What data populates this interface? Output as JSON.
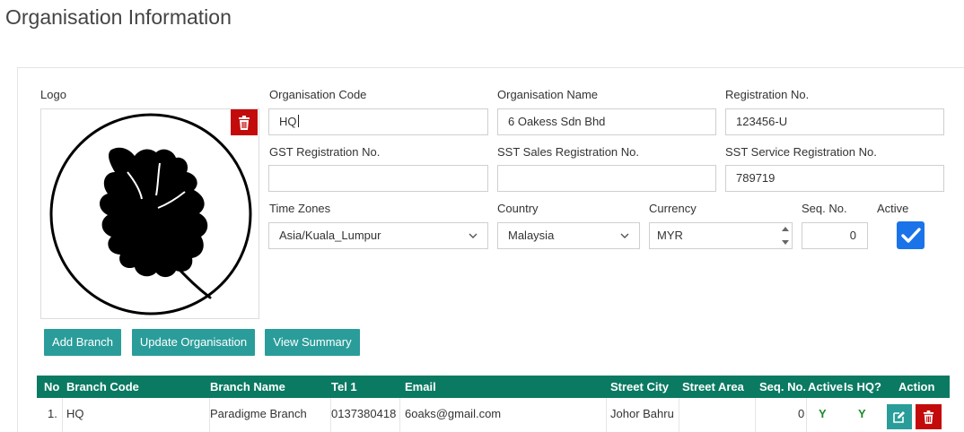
{
  "page": {
    "title": "Organisation Information"
  },
  "form": {
    "logo_label": "Logo",
    "org_code": {
      "label": "Organisation Code",
      "value": "HQ"
    },
    "org_name": {
      "label": "Organisation Name",
      "value": "6 Oakess Sdn Bhd"
    },
    "reg_no": {
      "label": "Registration No.",
      "value": "123456-U"
    },
    "gst_reg": {
      "label": "GST Registration No.",
      "value": ""
    },
    "sst_sales": {
      "label": "SST Sales Registration No.",
      "value": ""
    },
    "sst_service": {
      "label": "SST Service Registration No.",
      "value": "789719"
    },
    "timezone": {
      "label": "Time Zones",
      "value": "Asia/Kuala_Lumpur"
    },
    "country": {
      "label": "Country",
      "value": "Malaysia"
    },
    "currency": {
      "label": "Currency",
      "value": "MYR"
    },
    "seq_no": {
      "label": "Seq. No.",
      "value": "0"
    },
    "active": {
      "label": "Active",
      "checked": true
    }
  },
  "buttons": {
    "add_branch": "Add Branch",
    "update_org": "Update Organisation",
    "view_summary": "View Summary"
  },
  "table": {
    "headers": {
      "no": "No",
      "branch_code": "Branch Code",
      "branch_name": "Branch Name",
      "tel1": "Tel 1",
      "email": "Email",
      "street_city": "Street City",
      "street_area": "Street Area",
      "seq_no": "Seq. No.",
      "active": "Active",
      "is_hq": "Is HQ?",
      "action": "Action"
    },
    "rows": [
      {
        "no": "1.",
        "branch_code": "HQ",
        "branch_name": "Paradigme Branch",
        "tel1": "0137380418",
        "email": "6oaks@gmail.com",
        "street_city": "Johor Bahru",
        "street_area": "",
        "seq_no": "0",
        "active": "Y",
        "is_hq": "Y"
      }
    ]
  },
  "colors": {
    "table_header": "#0b7a62",
    "button_teal": "#2a9d9a",
    "delete_red": "#c40b0b",
    "checkbox_blue": "#1a73e8",
    "yes_green": "#1e8a2a"
  },
  "icons": {
    "logo_delete": "trash-icon",
    "row_edit": "edit-icon",
    "row_delete": "trash-icon",
    "select_arrow": "chevron-down-icon",
    "checkbox": "check-icon",
    "logo": "oak-leaf-logo"
  }
}
